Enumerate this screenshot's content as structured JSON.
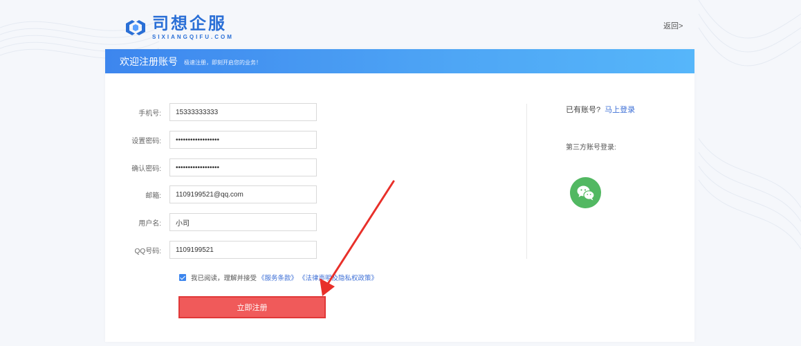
{
  "header": {
    "logo_cn": "司想企服",
    "logo_en": "SIXIANGQIFU.COM",
    "back_label": "返回>"
  },
  "card": {
    "title": "欢迎注册账号",
    "subtitle": "极速注册，即刻开启您的业务！"
  },
  "form": {
    "fields": [
      {
        "label": "手机号:",
        "value": "15333333333",
        "type": "text"
      },
      {
        "label": "设置密码:",
        "value": "••••••••••••••••••",
        "type": "password"
      },
      {
        "label": "确认密码:",
        "value": "••••••••••••••••••",
        "type": "password"
      },
      {
        "label": "邮箱:",
        "value": "1109199521@qq.com",
        "type": "text"
      },
      {
        "label": "用户名:",
        "value": "小司",
        "type": "text"
      },
      {
        "label": "QQ号码:",
        "value": "1109199521",
        "type": "text"
      }
    ],
    "agree_text": "我已阅读，理解并接受",
    "terms_link": "《服务条款》",
    "privacy_link": "《法律声明及隐私权政策》",
    "submit_label": "立即注册"
  },
  "side": {
    "has_account": "已有账号?",
    "login_link": "马上登录",
    "third_party": "第三方账号登录:"
  },
  "colors": {
    "accent": "#3d86ee",
    "submit": "#f05a5a",
    "wechat": "#52b862",
    "annotation_arrow": "#e8302a"
  },
  "icons": {
    "logo": "logo-mark-icon",
    "wechat": "wechat-icon",
    "checkbox": "checkbox-checked-icon",
    "annotation": "red-arrow-icon"
  }
}
